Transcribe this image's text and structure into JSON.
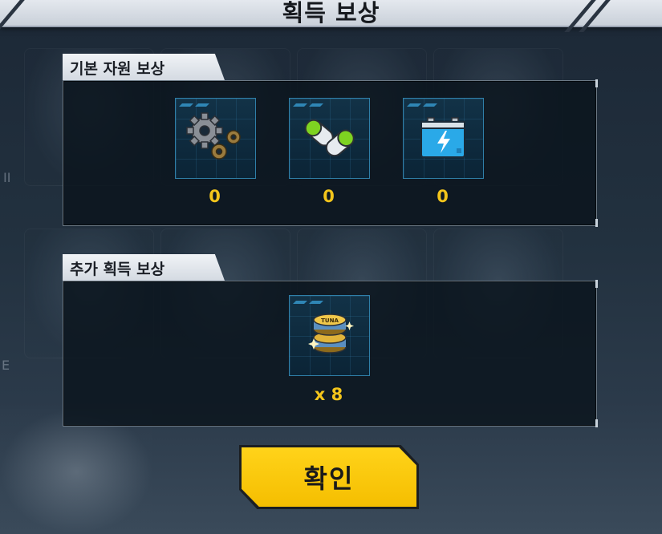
{
  "dialog": {
    "title": "획득 보상"
  },
  "basic_rewards": {
    "label": "기본 자원 보상",
    "items": [
      {
        "icon": "gears-icon",
        "count": "0"
      },
      {
        "icon": "capsule-pill-icon",
        "count": "0"
      },
      {
        "icon": "battery-icon",
        "count": "0"
      }
    ]
  },
  "extra_rewards": {
    "label": "추가 획득 보상",
    "items": [
      {
        "icon": "tuna-can-icon",
        "can_text": "TUNA",
        "count": "x 8"
      }
    ]
  },
  "confirm_button": {
    "label": "확인"
  },
  "colors": {
    "accent_yellow": "#ffcc00",
    "count_text": "#f3c51b",
    "slot_border": "#2f7fa8"
  }
}
